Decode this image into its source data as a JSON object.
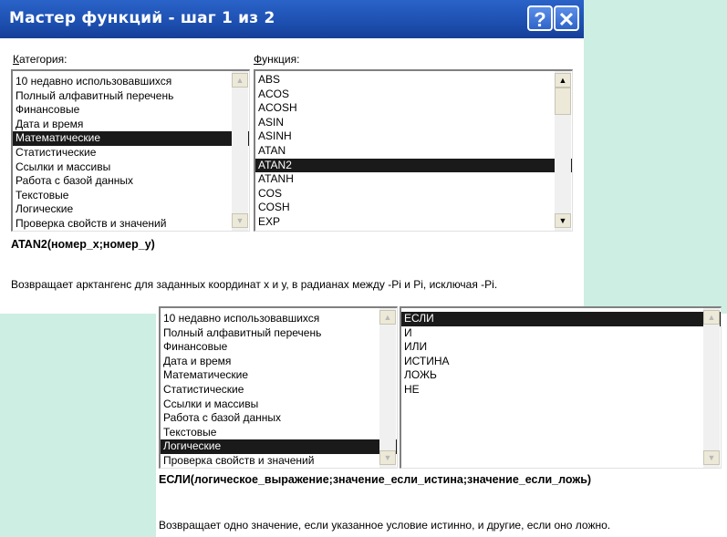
{
  "dialog1": {
    "title": "Мастер функций - шаг 1 из 2",
    "help_label": "?",
    "close_label": "✕",
    "category_label_key": "К",
    "category_label_rest": "атегория:",
    "function_label_key": "Ф",
    "function_label_rest": "ункция:",
    "categories": [
      "10 недавно использовавшихся",
      "Полный алфавитный перечень",
      "Финансовые",
      "Дата и время",
      "Математические",
      "Статистические",
      "Ссылки и массивы",
      "Работа с базой данных",
      "Текстовые",
      "Логические",
      "Проверка свойств и значений"
    ],
    "selected_category": "Математические",
    "functions": [
      "ABS",
      "ACOS",
      "ACOSH",
      "ASIN",
      "ASINH",
      "ATAN",
      "ATAN2",
      "ATANH",
      "COS",
      "COSH",
      "EXP"
    ],
    "selected_function": "ATAN2",
    "syntax": "ATAN2(номер_х;номер_у)",
    "description": "Возвращает арктангенс для заданных координат х и у, в радианах между -Pi и Pi, исключая -Pi."
  },
  "dialog2": {
    "categories": [
      "10 недавно использовавшихся",
      "Полный алфавитный перечень",
      "Финансовые",
      "Дата и время",
      "Математические",
      "Статистические",
      "Ссылки и массивы",
      "Работа с базой данных",
      "Текстовые",
      "Логические",
      "Проверка свойств и значений"
    ],
    "selected_category": "Логические",
    "functions": [
      "ЕСЛИ",
      "И",
      "ИЛИ",
      "ИСТИНА",
      "ЛОЖЬ",
      "НЕ"
    ],
    "selected_function": "ЕСЛИ",
    "syntax": "ЕСЛИ(логическое_выражение;значение_если_истина;значение_если_ложь)",
    "description": "Возвращает одно значение, если указанное условие истинно, и другие, если оно ложно."
  },
  "scroll": {
    "up_glyph": "▲",
    "down_glyph": "▼"
  },
  "colors": {
    "titlebar": "#1d4fb0",
    "background": "#cdeee2",
    "selection": "#1a1a1a"
  }
}
